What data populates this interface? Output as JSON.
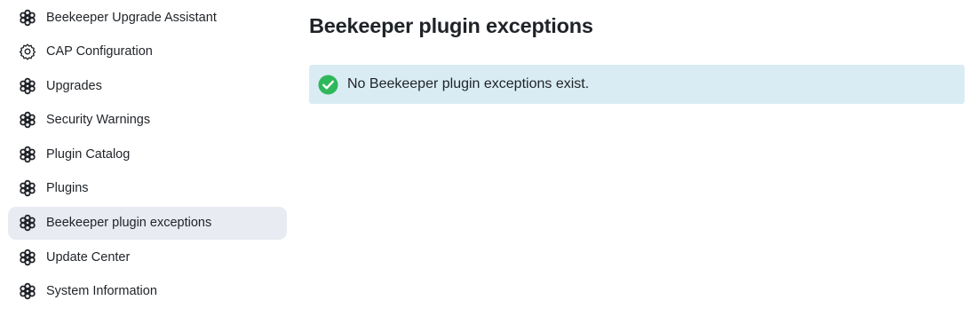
{
  "sidebar": {
    "items": [
      {
        "label": "Beekeeper Upgrade Assistant",
        "icon": "cog-icon",
        "active": false
      },
      {
        "label": "CAP Configuration",
        "icon": "gear-icon",
        "active": false
      },
      {
        "label": "Upgrades",
        "icon": "cog-icon",
        "active": false
      },
      {
        "label": "Security Warnings",
        "icon": "cog-icon",
        "active": false
      },
      {
        "label": "Plugin Catalog",
        "icon": "cog-icon",
        "active": false
      },
      {
        "label": "Plugins",
        "icon": "cog-icon",
        "active": false
      },
      {
        "label": "Beekeeper plugin exceptions",
        "icon": "cog-icon",
        "active": true
      },
      {
        "label": "Update Center",
        "icon": "cog-icon",
        "active": false
      },
      {
        "label": "System Information",
        "icon": "cog-icon",
        "active": false
      }
    ]
  },
  "main": {
    "title": "Beekeeper plugin exceptions",
    "alert": {
      "text": "No Beekeeper plugin exceptions exist.",
      "icon": "check-circle-icon"
    }
  },
  "colors": {
    "active_item_bg": "#e8ebf2",
    "alert_bg": "#d9ecf4",
    "success_green": "#2fb85a"
  }
}
